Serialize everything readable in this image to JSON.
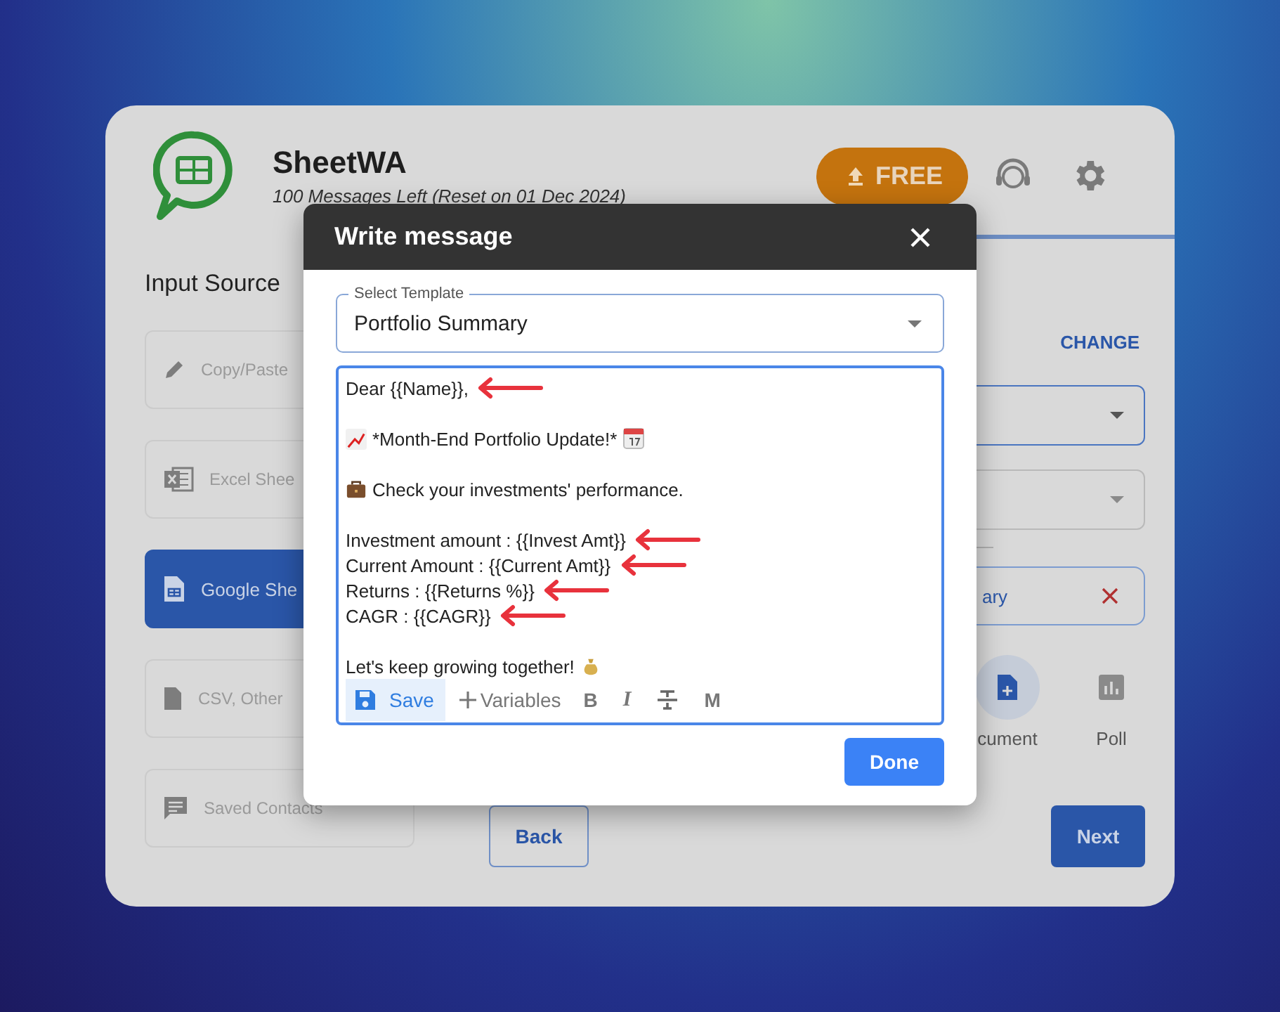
{
  "app": {
    "name": "SheetWA",
    "quota": "100 Messages Left (Reset on 01 Dec 2024)",
    "plan_button": "FREE"
  },
  "input_source": {
    "title": "Input Source",
    "items": [
      {
        "kind": "pencil",
        "label": "Copy/Paste",
        "selected": false
      },
      {
        "kind": "excel",
        "label": "Excel Shee",
        "selected": false
      },
      {
        "kind": "sheets",
        "label": "Google She",
        "selected": true
      },
      {
        "kind": "file",
        "label": "CSV, Other",
        "selected": false
      },
      {
        "kind": "chat",
        "label": "Saved Contacts",
        "selected": false
      }
    ]
  },
  "right_panel": {
    "change_link": "CHANGE",
    "chip_text": "ary",
    "attachments": [
      {
        "kind": "document",
        "label": "cument",
        "selected": true
      },
      {
        "kind": "poll",
        "label": "Poll",
        "selected": false
      }
    ]
  },
  "nav_buttons": {
    "back": "Back",
    "next": "Next"
  },
  "dialog": {
    "title": "Write message",
    "template_field": {
      "label": "Select Template",
      "value": "Portfolio Summary"
    },
    "message_lines": [
      {
        "kind": "text",
        "text": "Dear {{Name}},",
        "arrow": true
      },
      {
        "kind": "blank"
      },
      {
        "kind": "text",
        "lead_icon": {
          "kind": "chart"
        },
        "text": "*Month-End Portfolio Update!*",
        "trail_icon": {
          "kind": "calendar"
        },
        "arrow": false
      },
      {
        "kind": "blank"
      },
      {
        "kind": "text",
        "lead_icon": {
          "kind": "briefcase"
        },
        "text": "Check your investments' performance.",
        "arrow": false
      },
      {
        "kind": "blank"
      },
      {
        "kind": "text",
        "text": "Investment amount : {{Invest Amt}}",
        "arrow": true
      },
      {
        "kind": "text",
        "text": "Current Amount : {{Current Amt}}",
        "arrow": true
      },
      {
        "kind": "text",
        "text": "Returns : {{Returns %}}",
        "arrow": true
      },
      {
        "kind": "text",
        "text": "CAGR : {{CAGR}}",
        "arrow": true
      },
      {
        "kind": "blank"
      },
      {
        "kind": "text",
        "text": "Let's keep growing together!",
        "trail_icon": {
          "kind": "bag"
        },
        "arrow": false
      }
    ],
    "toolbar": [
      {
        "kind": "save",
        "label": "Save"
      },
      {
        "kind": "add",
        "label": "Variables"
      },
      {
        "kind": "bold",
        "label": "B"
      },
      {
        "kind": "italic",
        "label": "I"
      },
      {
        "kind": "strike"
      },
      {
        "kind": "mono",
        "label": "M"
      }
    ],
    "done_button": "Done"
  }
}
